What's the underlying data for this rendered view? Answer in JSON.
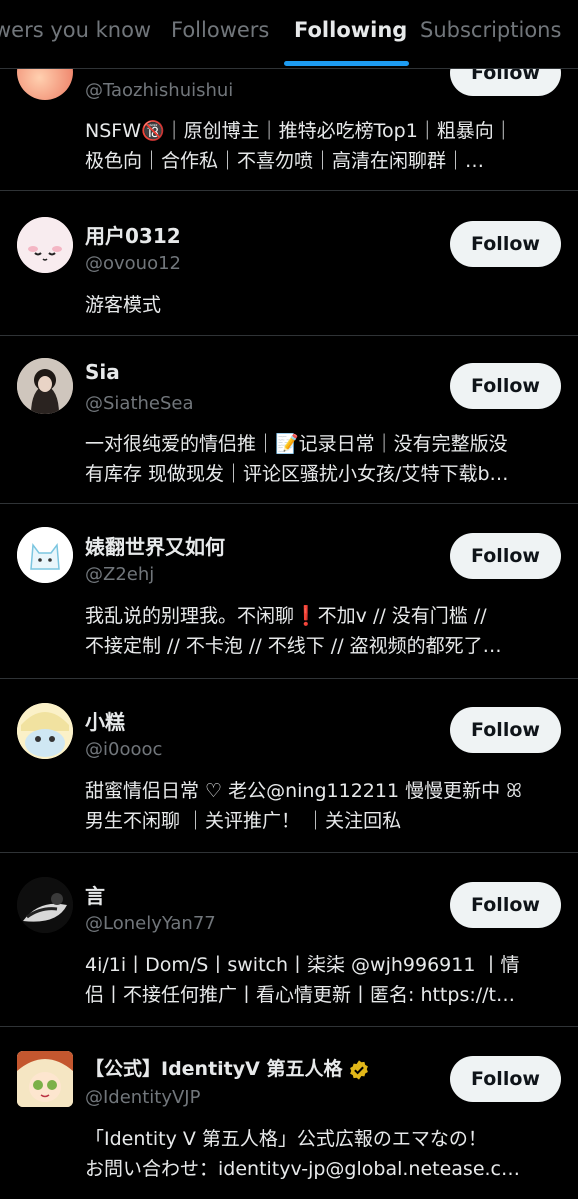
{
  "tabs": [
    {
      "label": "wers you know",
      "active": false
    },
    {
      "label": "Followers",
      "active": false
    },
    {
      "label": "Following",
      "active": true
    },
    {
      "label": "Subscriptions",
      "active": false
    }
  ],
  "follow_label": "Follow",
  "accounts": [
    {
      "name": "",
      "handle": "@Taozhishuishui",
      "bio": "NSFW🔞｜原创博主｜推特必吃榜Top1｜粗暴向｜\n极色向｜合作私｜不喜勿喷｜高清在闲聊群｜…"
    },
    {
      "name": "用户0312",
      "handle": "@ovouo12",
      "bio": "游客模式"
    },
    {
      "name": "Sia",
      "handle": "@SiatheSea",
      "bio": "一对很纯爱的情侣推｜📝记录日常｜没有完整版没\n有库存 现做现发｜评论区骚扰小女孩/艾特下载b…"
    },
    {
      "name": "婊翻世界又如何",
      "handle": "@Z2ehj",
      "bio": "我乱说的别理我。不闲聊❗不加v // 没有门槛 //\n不接定制 // 不卡泡 // 不线下 // 盗视频的都死了…"
    },
    {
      "name": "小糕",
      "handle": "@i0oooc",
      "bio": "甜蜜情侣日常 ♡ 老公@ning112211 慢慢更新中 ꕤ\n男生不闲聊 ｜关评推广！ ｜关注回私"
    },
    {
      "name": "言",
      "handle": "@LonelyYan77",
      "bio": "4i/1i丨Dom/S丨switch丨柒柒 @wjh996911 丨情\n侣丨不接任何推广丨看心情更新丨匿名: https://t…"
    },
    {
      "name": "【公式】IdentityV 第五人格",
      "handle": "@IdentityVJP",
      "bio": "「Identity V 第五人格」公式広報のエマなの！\nお問い合わせ：identityv-jp@global.netease.c…"
    }
  ]
}
